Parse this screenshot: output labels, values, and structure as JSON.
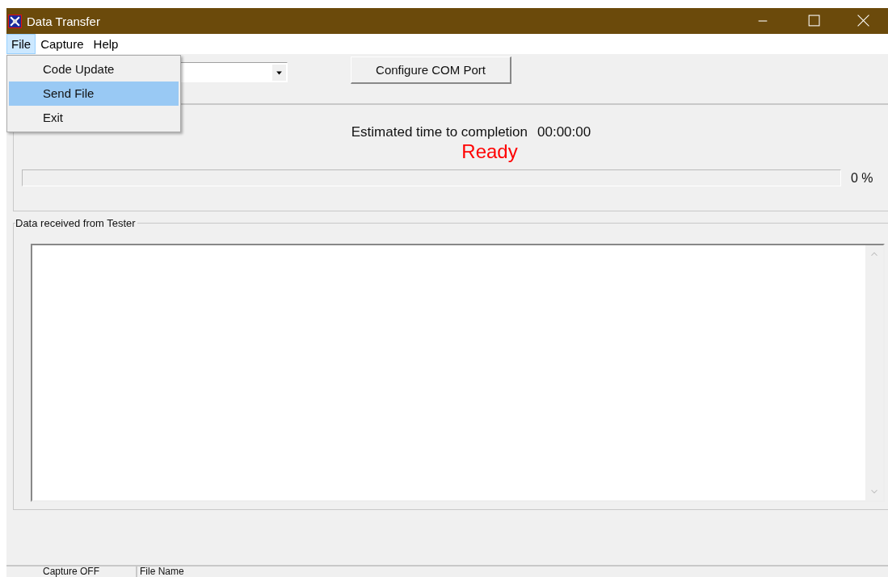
{
  "window": {
    "title": "Data Transfer"
  },
  "menu_bar": [
    {
      "label": "File",
      "selected": true
    },
    {
      "label": "Capture",
      "selected": false
    },
    {
      "label": "Help",
      "selected": false
    }
  ],
  "file_menu": {
    "items": [
      {
        "label": "Code Update",
        "selected": false
      },
      {
        "label": "Send File",
        "selected": true
      },
      {
        "label": "Exit",
        "selected": false
      }
    ]
  },
  "configure_button": "Configure COM Port",
  "progress": {
    "estimated_label": "Estimated time to completion",
    "estimated_time": "00:00:00",
    "status": "Ready",
    "level": 0,
    "percent": "0 %"
  },
  "data_group": {
    "title": "Data received from Tester"
  },
  "status_bar": [
    "Capture OFF",
    "File Name"
  ]
}
